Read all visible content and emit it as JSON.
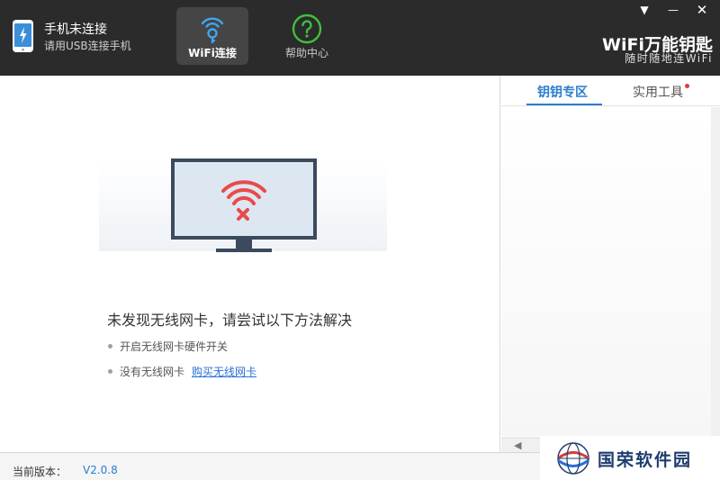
{
  "titlebar": {
    "phone_title": "手机未连接",
    "phone_subtitle": "请用USB连接手机",
    "tabs": [
      {
        "label": "WiFi连接",
        "icon": "wifi-key-icon",
        "active": true
      },
      {
        "label": "帮助中心",
        "icon": "help-icon",
        "active": false
      }
    ],
    "brand_title": "WiFi万能钥匙",
    "brand_slogan": "随时随地连WiFi",
    "window_controls": [
      "menu-icon",
      "minimize-icon",
      "close-icon"
    ]
  },
  "main": {
    "message": "未发现无线网卡，请尝试以下方法解决",
    "tips": [
      {
        "text": "开启无线网卡硬件开关"
      },
      {
        "text": "没有无线网卡",
        "link": "购买无线网卡"
      }
    ]
  },
  "right_panel": {
    "tabs": [
      {
        "label": "钥钥专区",
        "active": true
      },
      {
        "label": "实用工具",
        "active": false,
        "badge": true
      }
    ]
  },
  "status": {
    "version_label": "当前版本：",
    "version_value": "V2.0.8"
  },
  "watermark": {
    "text": "国荣软件园"
  },
  "colors": {
    "titlebar_bg": "#2b2b2b",
    "accent_blue": "#2a7ecf",
    "help_green": "#3fbf3f",
    "wifi_red": "#e94a4a",
    "monitor_frame": "#3b4a5c"
  }
}
